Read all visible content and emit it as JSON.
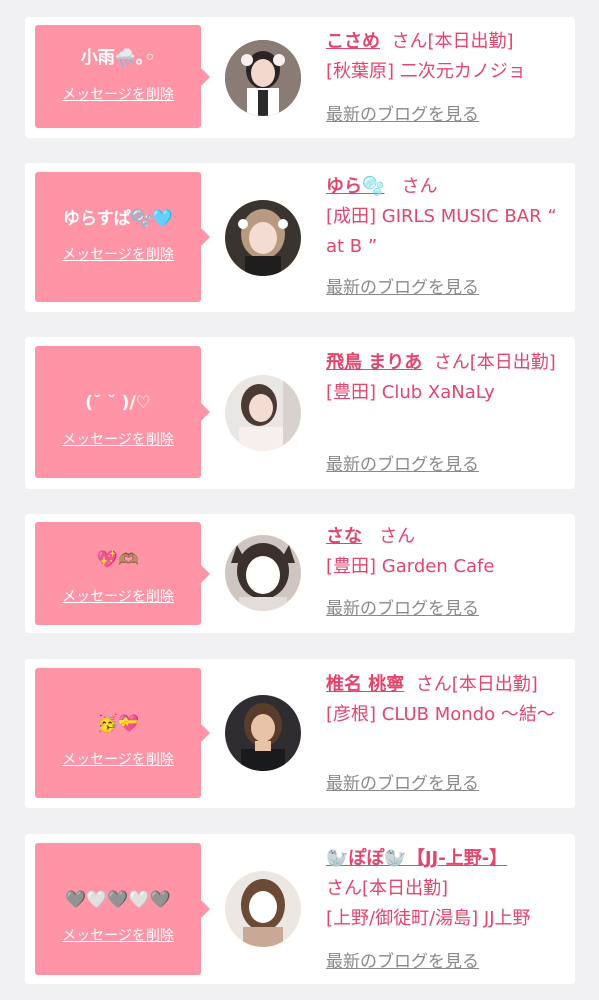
{
  "common": {
    "delete_label": "メッセージを削除",
    "blog_label": "最新のブログを見る",
    "san": "さん",
    "on_duty": "[本日出勤]"
  },
  "cards": [
    {
      "message": "小雨🌧️｡◦",
      "name": "こさめ",
      "on_duty": true,
      "shop": "[秋葉原] 二次元カノジョ"
    },
    {
      "message": "ゆらすぱ🫧🩵",
      "name": "ゆら🫧",
      "on_duty": false,
      "shop": "[成田] GIRLS MUSIC BAR “ at B ”"
    },
    {
      "message": "(˘ ˘ )/♡",
      "name": "飛鳥 まりあ",
      "on_duty": true,
      "shop": "[豊田] Club XaNaLy"
    },
    {
      "message": "💖🫶🏽",
      "name": "さな",
      "on_duty": false,
      "shop": "[豊田] Garden Cafe"
    },
    {
      "message": "🥳💝",
      "name": "椎名 桃寧",
      "on_duty": true,
      "shop": "[彦根] CLUB Mondo 〜結〜"
    },
    {
      "message": "🩶🤍🩶🤍🩶",
      "name": "🦭ぽぽ🦭【JJ-上野-】",
      "on_duty": true,
      "shop": "[上野/御徒町/湯島] JJ上野"
    }
  ],
  "colors": {
    "bubble": "#ff94a6",
    "accent": "#e4456d",
    "link_gray": "#8a8a8a",
    "background": "#f1f1f3"
  }
}
